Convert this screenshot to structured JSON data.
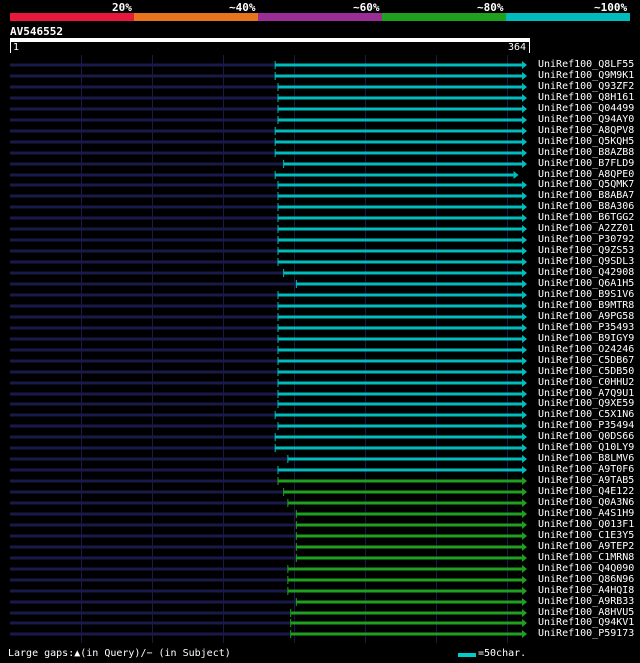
{
  "legend": {
    "segments": [
      {
        "label": "20%",
        "color": "#e6193c"
      },
      {
        "label": "~40%",
        "color": "#e8731e"
      },
      {
        "label": "~60%",
        "color": "#9b2d96"
      },
      {
        "label": "~80%",
        "color": "#1fa01f"
      },
      {
        "label": "~100%",
        "color": "#00bcbc"
      }
    ]
  },
  "query": {
    "id": "AV546552",
    "start_label": "1",
    "end_label": "364",
    "length": 364
  },
  "colors": {
    "background": "#000000",
    "gap_line": "#1a1a4a",
    "cyan": "#00bcbc",
    "green": "#1fa01f"
  },
  "hits": [
    {
      "name": "UniRef100_Q8LF55",
      "start": 189,
      "end": 364,
      "color": "cyan"
    },
    {
      "name": "UniRef100_Q9M9K1",
      "start": 189,
      "end": 364,
      "color": "cyan"
    },
    {
      "name": "UniRef100_Q93ZF2",
      "start": 191,
      "end": 364,
      "color": "cyan"
    },
    {
      "name": "UniRef100_Q8H161",
      "start": 191,
      "end": 364,
      "color": "cyan"
    },
    {
      "name": "UniRef100_Q04499",
      "start": 191,
      "end": 364,
      "color": "cyan"
    },
    {
      "name": "UniRef100_Q94AY0",
      "start": 191,
      "end": 364,
      "color": "cyan"
    },
    {
      "name": "UniRef100_A8QPV8",
      "start": 189,
      "end": 364,
      "color": "cyan"
    },
    {
      "name": "UniRef100_Q5KQH5",
      "start": 189,
      "end": 364,
      "color": "cyan"
    },
    {
      "name": "UniRef100_B8AZB8",
      "start": 189,
      "end": 364,
      "color": "cyan"
    },
    {
      "name": "UniRef100_B7FLD9",
      "start": 195,
      "end": 364,
      "color": "cyan"
    },
    {
      "name": "UniRef100_A8QPE0",
      "start": 189,
      "end": 358,
      "color": "cyan"
    },
    {
      "name": "UniRef100_Q5QMK7",
      "start": 191,
      "end": 364,
      "color": "cyan"
    },
    {
      "name": "UniRef100_B8ABA7",
      "start": 191,
      "end": 364,
      "color": "cyan"
    },
    {
      "name": "UniRef100_B8A306",
      "start": 191,
      "end": 364,
      "color": "cyan"
    },
    {
      "name": "UniRef100_B6TGG2",
      "start": 191,
      "end": 364,
      "color": "cyan"
    },
    {
      "name": "UniRef100_A2ZZ01",
      "start": 191,
      "end": 364,
      "color": "cyan"
    },
    {
      "name": "UniRef100_P30792",
      "start": 191,
      "end": 364,
      "color": "cyan"
    },
    {
      "name": "UniRef100_Q9ZS53",
      "start": 191,
      "end": 364,
      "color": "cyan"
    },
    {
      "name": "UniRef100_Q9SDL3",
      "start": 191,
      "end": 364,
      "color": "cyan"
    },
    {
      "name": "UniRef100_Q42908",
      "start": 195,
      "end": 364,
      "color": "cyan"
    },
    {
      "name": "UniRef100_Q6A1H5",
      "start": 204,
      "end": 364,
      "color": "cyan"
    },
    {
      "name": "UniRef100_B9S1V6",
      "start": 191,
      "end": 364,
      "color": "cyan"
    },
    {
      "name": "UniRef100_B9MTR8",
      "start": 191,
      "end": 364,
      "color": "cyan"
    },
    {
      "name": "UniRef100_A9PG58",
      "start": 191,
      "end": 364,
      "color": "cyan"
    },
    {
      "name": "UniRef100_P35493",
      "start": 191,
      "end": 364,
      "color": "cyan"
    },
    {
      "name": "UniRef100_B9IGY9",
      "start": 191,
      "end": 364,
      "color": "cyan"
    },
    {
      "name": "UniRef100_O24246",
      "start": 191,
      "end": 364,
      "color": "cyan"
    },
    {
      "name": "UniRef100_C5DB67",
      "start": 191,
      "end": 364,
      "color": "cyan"
    },
    {
      "name": "UniRef100_C5DB50",
      "start": 191,
      "end": 364,
      "color": "cyan"
    },
    {
      "name": "UniRef100_C0HHU2",
      "start": 191,
      "end": 364,
      "color": "cyan"
    },
    {
      "name": "UniRef100_A7Q9U1",
      "start": 191,
      "end": 364,
      "color": "cyan"
    },
    {
      "name": "UniRef100_Q9XE59",
      "start": 191,
      "end": 364,
      "color": "cyan"
    },
    {
      "name": "UniRef100_C5X1N6",
      "start": 189,
      "end": 364,
      "color": "cyan"
    },
    {
      "name": "UniRef100_P35494",
      "start": 191,
      "end": 364,
      "color": "cyan"
    },
    {
      "name": "UniRef100_Q0DS66",
      "start": 189,
      "end": 364,
      "color": "cyan"
    },
    {
      "name": "UniRef100_Q10LY9",
      "start": 189,
      "end": 364,
      "color": "cyan"
    },
    {
      "name": "UniRef100_B8LMV6",
      "start": 198,
      "end": 364,
      "color": "cyan"
    },
    {
      "name": "UniRef100_A9T0F6",
      "start": 191,
      "end": 364,
      "color": "cyan"
    },
    {
      "name": "UniRef100_A9TAB5",
      "start": 191,
      "end": 364,
      "color": "green"
    },
    {
      "name": "UniRef100_Q4E122",
      "start": 195,
      "end": 364,
      "color": "green"
    },
    {
      "name": "UniRef100_Q0A3N6",
      "start": 198,
      "end": 364,
      "color": "green"
    },
    {
      "name": "UniRef100_A4S1H9",
      "start": 204,
      "end": 364,
      "color": "green"
    },
    {
      "name": "UniRef100_Q013F1",
      "start": 204,
      "end": 364,
      "color": "green"
    },
    {
      "name": "UniRef100_C1E3Y5",
      "start": 204,
      "end": 364,
      "color": "green"
    },
    {
      "name": "UniRef100_A9TEP2",
      "start": 204,
      "end": 364,
      "color": "green"
    },
    {
      "name": "UniRef100_C1MRN8",
      "start": 204,
      "end": 364,
      "color": "green"
    },
    {
      "name": "UniRef100_Q4Q090",
      "start": 198,
      "end": 364,
      "color": "green"
    },
    {
      "name": "UniRef100_Q86N96",
      "start": 198,
      "end": 364,
      "color": "green"
    },
    {
      "name": "UniRef100_A4HQI8",
      "start": 198,
      "end": 364,
      "color": "green"
    },
    {
      "name": "UniRef100_A9RB33",
      "start": 204,
      "end": 364,
      "color": "green"
    },
    {
      "name": "UniRef100_A8HVU5",
      "start": 200,
      "end": 364,
      "color": "green"
    },
    {
      "name": "UniRef100_Q94KV1",
      "start": 200,
      "end": 364,
      "color": "green"
    },
    {
      "name": "UniRef100_P59173",
      "start": 200,
      "end": 364,
      "color": "green"
    }
  ],
  "footer": {
    "gaps_text": "Large gaps:▲(in Query)/− (in Subject)",
    "scale_text": "=50char."
  }
}
